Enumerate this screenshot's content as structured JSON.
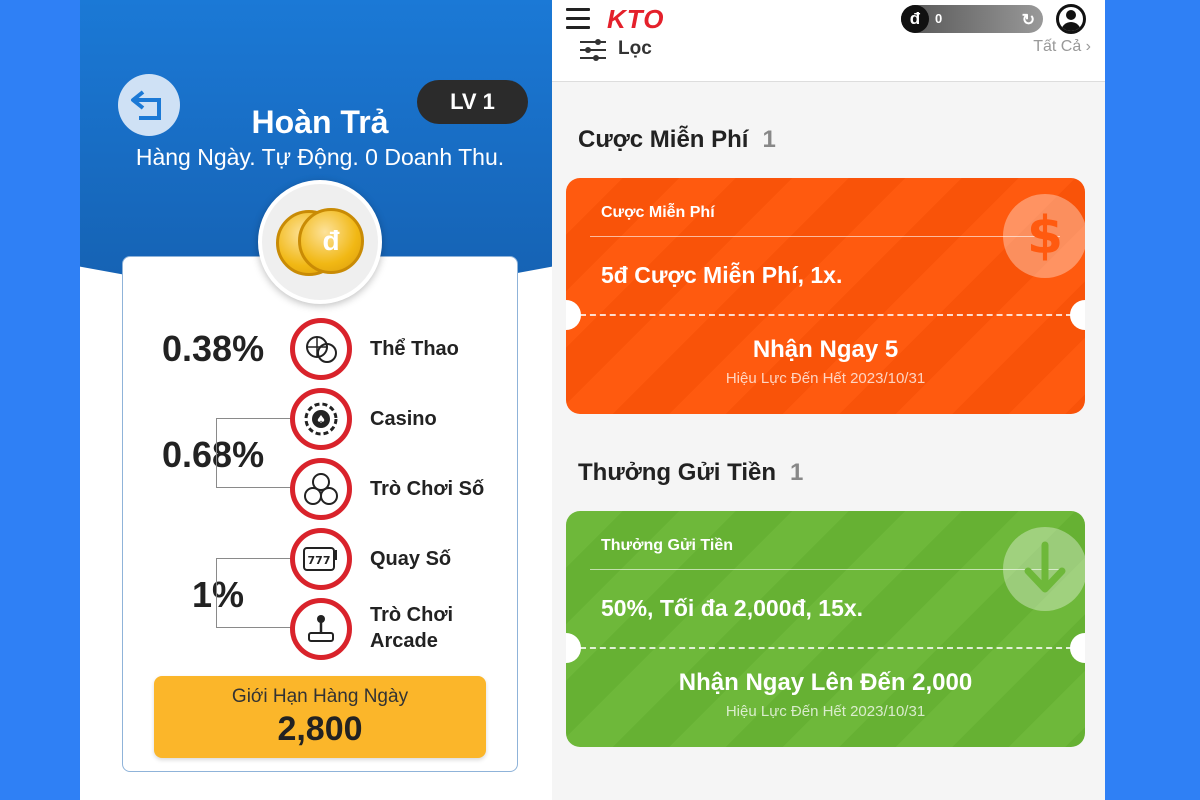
{
  "left": {
    "back_icon": "back-arrow-icon",
    "level": "LV 1",
    "title": "Hoàn Trả",
    "subtitle": "Hàng Ngày. Tự Động. 0 Doanh Thu.",
    "coin_symbol": "đ",
    "rates": [
      {
        "percent": "0.38%"
      },
      {
        "percent": "0.68%"
      },
      {
        "percent": "1%"
      }
    ],
    "categories": [
      {
        "label": "Thể Thao",
        "icon": "sports-ball-icon"
      },
      {
        "label": "Casino",
        "icon": "casino-chip-icon"
      },
      {
        "label": "Trò Chơi Số",
        "icon": "lottery-balls-icon"
      },
      {
        "label": "Quay Số",
        "icon": "slot-machine-icon"
      },
      {
        "label_line1": "Trò Chơi",
        "label_line2": "Arcade",
        "icon": "joystick-icon"
      }
    ],
    "daily_limit": {
      "label": "Giới Hạn Hàng Ngày",
      "value": "2,800"
    },
    "accent_color": "#d9232b",
    "limit_color": "#fbb62a"
  },
  "right": {
    "logo": "KTO",
    "wallet": {
      "currency_symbol": "đ",
      "balance": "0"
    },
    "filter": {
      "label": "Lọc",
      "all": "Tất Cả"
    },
    "sections": [
      {
        "title": "Cược Miễn Phí",
        "count": "1",
        "ticket": {
          "category": "Cược Miễn Phí",
          "description": "5đ Cược Miễn Phí, 1x.",
          "claim": "Nhận Ngay 5",
          "validity": "Hiệu Lực Đến Hết 2023/10/31",
          "badge_icon": "dollar-icon",
          "color": "#ff5a0f"
        }
      },
      {
        "title": "Thưởng Gửi Tiền",
        "count": "1",
        "ticket": {
          "category": "Thưởng Gửi Tiền",
          "description": "50%, Tối đa 2,000đ, 15x.",
          "claim": "Nhận Ngay Lên Đến 2,000",
          "validity": "Hiệu Lực Đến Hết 2023/10/31",
          "badge_icon": "arrow-down-icon",
          "color": "#6eb83a"
        }
      }
    ]
  }
}
